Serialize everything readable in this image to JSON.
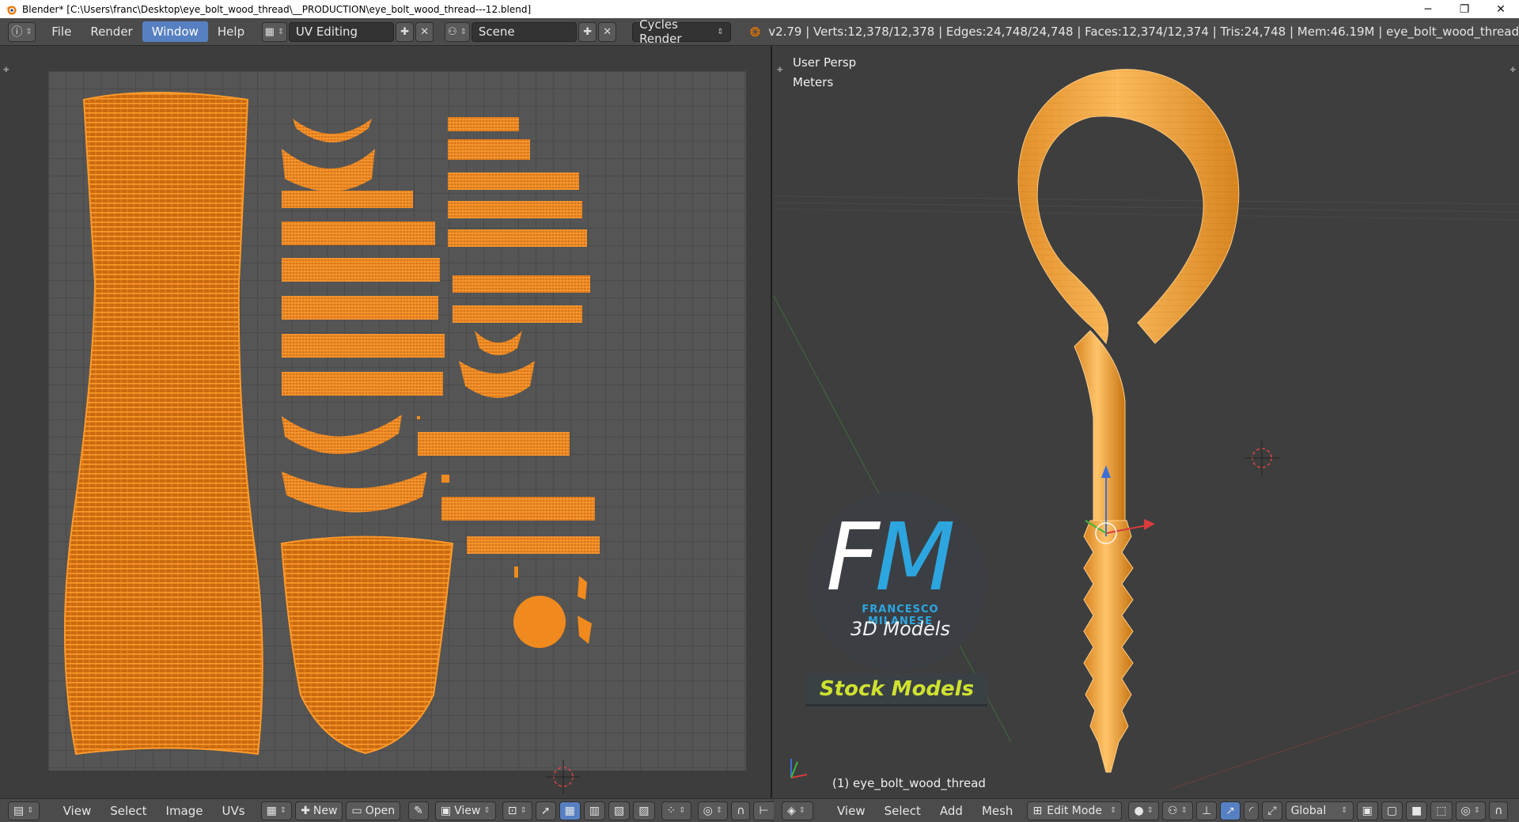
{
  "window": {
    "title": "Blender* [C:\\Users\\franc\\Desktop\\eye_bolt_wood_thread\\__PRODUCTION\\eye_bolt_wood_thread---12.blend]",
    "minimize": "─",
    "maximize": "❐",
    "close": "✕"
  },
  "header": {
    "info_icon": "info-icon",
    "menus": [
      "File",
      "Render",
      "Window",
      "Help"
    ],
    "active_menu": "Window",
    "layout": {
      "value": "UV Editing"
    },
    "scene": {
      "value": "Scene"
    },
    "engine": {
      "value": "Cycles Render"
    },
    "stats": "v2.79 | Verts:12,378/12,378 | Edges:24,748/24,748 | Faces:12,374/12,374 | Tris:24,748 | Mem:46.19M | eye_bolt_wood_thread"
  },
  "viewport": {
    "persp_label": "User Persp",
    "units_label": "Meters",
    "object_label": "(1) eye_bolt_wood_thread"
  },
  "watermark": {
    "fm_f": "F",
    "fm_m": "M",
    "name": "FRANCESCO MILANESE",
    "sub": "3D Models",
    "banner": "Stock Models"
  },
  "uv_footer": {
    "menus": [
      "View",
      "Select",
      "Image",
      "UVs"
    ],
    "new_label": "New",
    "open_label": "Open",
    "view_label": "View"
  },
  "view3d_footer": {
    "menus": [
      "View",
      "Select",
      "Add",
      "Mesh"
    ],
    "mode": "Edit Mode",
    "orientation": "Global"
  },
  "colors": {
    "mesh": "#f7931e",
    "accent": "#5680c2",
    "brand_blue": "#2da6e0",
    "brand_yellow": "#cfe22e"
  }
}
